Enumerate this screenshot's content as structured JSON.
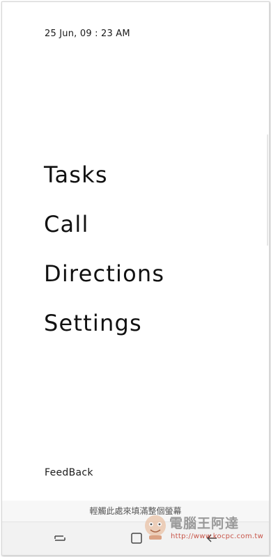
{
  "status": {
    "datetime": "25 Jun, 09 : 23 AM"
  },
  "menu": {
    "items": [
      {
        "label": "Tasks"
      },
      {
        "label": "Call"
      },
      {
        "label": "Directions"
      },
      {
        "label": "Settings"
      }
    ]
  },
  "footer": {
    "feedback_label": "FeedBack"
  },
  "hint": {
    "text": "輕觸此處來填滿整個螢幕"
  },
  "navigation": {
    "recents_icon": "recents-icon",
    "home_icon": "home-icon",
    "back_icon": "back-arrow-icon"
  },
  "watermark": {
    "title": "電腦王阿達",
    "url": "http://www.kocpc.com.tw"
  },
  "colors": {
    "text": "#111111",
    "background": "#ffffff",
    "navbar": "#f2f2f2",
    "watermark_url": "#c0392b"
  }
}
